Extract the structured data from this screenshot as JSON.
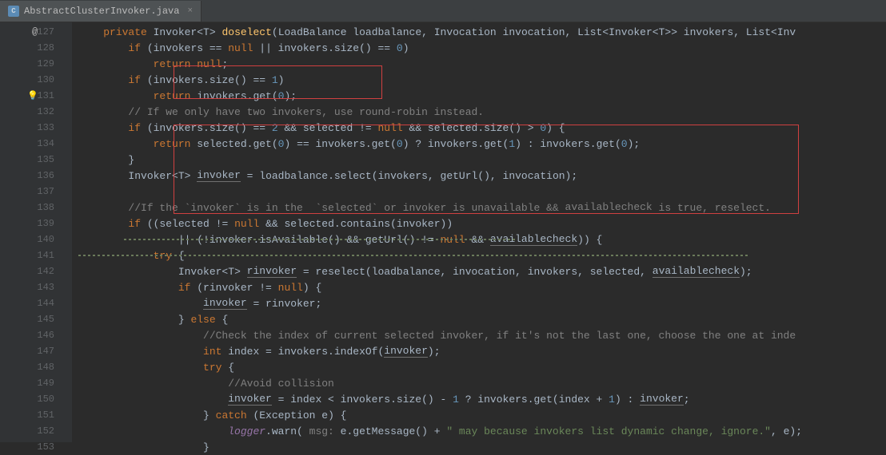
{
  "tab": {
    "icon_letter": "C",
    "filename": "AbstractClusterInvoker.java",
    "close": "×"
  },
  "gutter": {
    "start": 127,
    "end": 153,
    "at_symbol": "@",
    "bulb_line": 131
  },
  "code": {
    "l127": {
      "indent": "    ",
      "t": [
        [
          "kw",
          "private"
        ],
        [
          "ident",
          " Invoker<"
        ],
        [
          "type",
          "T"
        ],
        [
          "ident",
          "> "
        ],
        [
          "method",
          "doselect"
        ],
        [
          "ident",
          "(LoadBalance loadbalance, Invocation invocation, List<Invoker<"
        ],
        [
          "type",
          "T"
        ],
        [
          "ident",
          ">> invokers, List<Inv"
        ]
      ]
    },
    "l128": {
      "indent": "        ",
      "t": [
        [
          "kw",
          "if"
        ],
        [
          "ident",
          " (invokers == "
        ],
        [
          "kw",
          "null"
        ],
        [
          "ident",
          " || invokers.size() == "
        ],
        [
          "num",
          "0"
        ],
        [
          "ident",
          ")"
        ]
      ]
    },
    "l129": {
      "indent": "            ",
      "t": [
        [
          "kw",
          "return null"
        ],
        [
          "ident",
          ";"
        ]
      ]
    },
    "l130": {
      "indent": "        ",
      "t": [
        [
          "kw",
          "if"
        ],
        [
          "ident",
          " (invokers.size() == "
        ],
        [
          "num",
          "1"
        ],
        [
          "ident",
          ")"
        ]
      ]
    },
    "l131": {
      "indent": "            ",
      "t": [
        [
          "kw",
          "return"
        ],
        [
          "ident",
          " invokers.get("
        ],
        [
          "num",
          "0"
        ],
        [
          "ident",
          ");"
        ]
      ]
    },
    "l132": {
      "indent": "        ",
      "t": [
        [
          "comment",
          "// If we only have two invokers, use round-robin instead."
        ]
      ]
    },
    "l133": {
      "indent": "        ",
      "t": [
        [
          "kw",
          "if"
        ],
        [
          "ident",
          " (invokers.size() == "
        ],
        [
          "num",
          "2"
        ],
        [
          "ident",
          " && selected != "
        ],
        [
          "kw",
          "null"
        ],
        [
          "ident",
          " && selected.size() > "
        ],
        [
          "num",
          "0"
        ],
        [
          "ident",
          ") {"
        ]
      ]
    },
    "l134": {
      "indent": "            ",
      "t": [
        [
          "kw",
          "return"
        ],
        [
          "ident",
          " selected.get("
        ],
        [
          "num",
          "0"
        ],
        [
          "ident",
          ") == invokers.get("
        ],
        [
          "num",
          "0"
        ],
        [
          "ident",
          ") ? invokers.get("
        ],
        [
          "num",
          "1"
        ],
        [
          "ident",
          ") : invokers.get("
        ],
        [
          "num",
          "0"
        ],
        [
          "ident",
          ");"
        ]
      ]
    },
    "l135": {
      "indent": "        ",
      "t": [
        [
          "ident",
          "}"
        ]
      ]
    },
    "l136": {
      "indent": "        ",
      "t": [
        [
          "ident",
          "Invoker<"
        ],
        [
          "type",
          "T"
        ],
        [
          "ident",
          "> "
        ],
        [
          "underline2",
          "invoker"
        ],
        [
          "ident",
          " = loadbalance.select(invokers, getUrl(), invocation);"
        ]
      ]
    },
    "l137": {
      "indent": "",
      "t": []
    },
    "l138": {
      "indent": "        ",
      "t": [
        [
          "comment",
          "//If the `invoker` is in the  `selected` or invoker is unavailable && "
        ],
        [
          "comment underline2",
          "availablecheck"
        ],
        [
          "comment",
          " is true, reselect."
        ]
      ]
    },
    "l139": {
      "indent": "        ",
      "t": [
        [
          "kw",
          "if"
        ],
        [
          "ident",
          " ((selected != "
        ],
        [
          "kw",
          "null"
        ],
        [
          "ident",
          " && selected.contains(invoker))"
        ]
      ]
    },
    "l140": {
      "indent": "                ",
      "t": [
        [
          "ident",
          "|| (!invoker.isAvailable() && getUrl() != "
        ],
        [
          "kw",
          "null"
        ],
        [
          "ident",
          " && "
        ],
        [
          "underline2",
          "availablecheck"
        ],
        [
          "ident",
          ")) {"
        ]
      ]
    },
    "l141": {
      "indent": "            ",
      "t": [
        [
          "kw",
          "try"
        ],
        [
          "ident",
          " {"
        ]
      ]
    },
    "l142": {
      "indent": "                ",
      "t": [
        [
          "ident",
          "Invoker<"
        ],
        [
          "type",
          "T"
        ],
        [
          "ident",
          "> "
        ],
        [
          "underline2",
          "rinvoker"
        ],
        [
          "ident",
          " = reselect(loadbalance, invocation, invokers, selected, "
        ],
        [
          "underline2",
          "availablecheck"
        ],
        [
          "ident",
          ");"
        ]
      ]
    },
    "l143": {
      "indent": "                ",
      "t": [
        [
          "kw",
          "if"
        ],
        [
          "ident",
          " (rinvoker != "
        ],
        [
          "kw",
          "null"
        ],
        [
          "ident",
          ") {"
        ]
      ]
    },
    "l144": {
      "indent": "                    ",
      "t": [
        [
          "underline2",
          "invoker"
        ],
        [
          "ident",
          " = rinvoker;"
        ]
      ]
    },
    "l145": {
      "indent": "                ",
      "t": [
        [
          "ident",
          "} "
        ],
        [
          "kw",
          "else"
        ],
        [
          "ident",
          " {"
        ]
      ]
    },
    "l146": {
      "indent": "                    ",
      "t": [
        [
          "comment",
          "//Check the index of current selected invoker, if it's not the last one, choose the one at inde"
        ]
      ]
    },
    "l147": {
      "indent": "                    ",
      "t": [
        [
          "kw",
          "int"
        ],
        [
          "ident",
          " index = invokers.indexOf("
        ],
        [
          "underline2",
          "invoker"
        ],
        [
          "ident",
          ");"
        ]
      ]
    },
    "l148": {
      "indent": "                    ",
      "t": [
        [
          "kw",
          "try"
        ],
        [
          "ident",
          " {"
        ]
      ]
    },
    "l149": {
      "indent": "                        ",
      "t": [
        [
          "comment",
          "//Avoid collision"
        ]
      ]
    },
    "l150": {
      "indent": "                        ",
      "t": [
        [
          "underline2",
          "invoker"
        ],
        [
          "ident",
          " = index < invokers.size() - "
        ],
        [
          "num",
          "1"
        ],
        [
          "ident",
          " ? invokers.get(index + "
        ],
        [
          "num",
          "1"
        ],
        [
          "ident",
          ") : "
        ],
        [
          "underline2",
          "invoker"
        ],
        [
          "ident",
          ";"
        ]
      ]
    },
    "l151": {
      "indent": "                    ",
      "t": [
        [
          "ident",
          "} "
        ],
        [
          "kw",
          "catch"
        ],
        [
          "ident",
          " (Exception e) {"
        ]
      ]
    },
    "l152": {
      "indent": "                        ",
      "t": [
        [
          "field",
          "logger"
        ],
        [
          "ident",
          ".warn( "
        ],
        [
          "comment",
          "msg:"
        ],
        [
          "ident",
          " e.getMessage() + "
        ],
        [
          "str",
          "\" may because invokers list dynamic change, ignore.\""
        ],
        [
          "ident",
          ", e);"
        ]
      ]
    },
    "l153": {
      "indent": "                    ",
      "t": [
        [
          "ident",
          "}"
        ]
      ]
    }
  }
}
